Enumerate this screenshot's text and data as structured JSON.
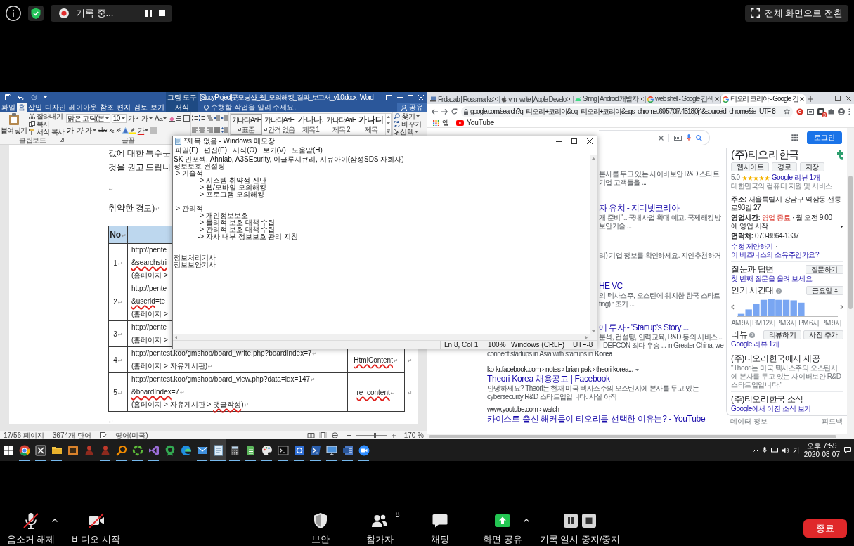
{
  "top_bar": {
    "recording_label": "기록 중...",
    "fullscreen_button": "전체 화면으로 전환"
  },
  "word": {
    "context_label": "그림 도구",
    "title": "[StudyProject]굿모닝샵_웹_모의해킹_결과_보고서_v1.0.docx - Word",
    "tabs": [
      {
        "label": "파일",
        "selected": false,
        "contextual": false
      },
      {
        "label": "홈",
        "selected": true,
        "contextual": false
      },
      {
        "label": "삽입",
        "selected": false,
        "contextual": false
      },
      {
        "label": "디자인",
        "selected": false,
        "contextual": false
      },
      {
        "label": "레이아웃",
        "selected": false,
        "contextual": false
      },
      {
        "label": "참조",
        "selected": false,
        "contextual": false
      },
      {
        "label": "편지",
        "selected": false,
        "contextual": false
      },
      {
        "label": "검토",
        "selected": false,
        "contextual": false
      },
      {
        "label": "보기",
        "selected": false,
        "contextual": false
      },
      {
        "label": "서식",
        "selected": false,
        "contextual": true
      }
    ],
    "tell_me": {
      "placeholder": "수행할 작업을 알려 주세요."
    },
    "share": "공유",
    "clipboard": {
      "paste": "붙여넣기",
      "cut": "잘라내기",
      "copy": "복사",
      "format_painter": "서식 복사",
      "label": "클립보드"
    },
    "font": {
      "name": "맑은 고딕(본",
      "size": "10",
      "grow": "가",
      "shrink": "가",
      "change_case": "Aa",
      "bold": "가",
      "italic": "가",
      "underline": "가",
      "strikethrough": "abc",
      "subscript": "x₂",
      "superscript": "x²",
      "font_color": "가",
      "label": "글꼴"
    },
    "styles": [
      {
        "preview": "가나다AaE",
        "label": "표준",
        "kind": "body",
        "selected": true,
        "paragraph_mark": true
      },
      {
        "preview": "가나다AaE",
        "label": "간격 없음",
        "kind": "body",
        "selected": false,
        "paragraph_mark": true
      },
      {
        "preview": "가나다.",
        "label": "제목 1",
        "kind": "heading",
        "selected": false,
        "paragraph_mark": false
      },
      {
        "preview": "가나다AaE",
        "label": "제목 2",
        "kind": "body",
        "selected": false,
        "paragraph_mark": false
      },
      {
        "preview": "가나디",
        "label": "제목",
        "kind": "title",
        "selected": false,
        "paragraph_mark": false
      }
    ],
    "editing": {
      "find": "찾기",
      "replace": "바꾸기",
      "select": "선택"
    },
    "document": {
      "paragraphs": [
        {
          "text": "값에 대한 특수문"
        },
        {
          "text": "것을 권고 드립니"
        },
        {
          "mark": "↵"
        },
        {
          "text": "취약한 경로)",
          "mark": "↵"
        }
      ],
      "table": {
        "header": {
          "text": "No",
          "mark": "↵"
        },
        "rows": [
          {
            "number": "1",
            "mark": "↵",
            "lines": [
              {
                "parts": [
                  {
                    "text": "http://pente",
                    "misspelled": false
                  }
                ]
              },
              {
                "parts": [
                  {
                    "text": "&searchstri",
                    "misspelled": true
                  }
                ]
              },
              {
                "parts": [
                  {
                    "text": "(홈페이지 >",
                    "misspelled": false
                  }
                ]
              }
            ]
          },
          {
            "number": "2",
            "mark": "↵",
            "lines": [
              {
                "parts": [
                  {
                    "text": "http://pente",
                    "misspelled": false
                  }
                ]
              },
              {
                "parts": [
                  {
                    "text": "&userid",
                    "misspelled": true
                  },
                  {
                    "text": "=te",
                    "misspelled": false
                  }
                ]
              },
              {
                "parts": [
                  {
                    "text": "(홈페이지 >",
                    "misspelled": false
                  }
                ]
              }
            ]
          },
          {
            "number": "3",
            "mark": "↵",
            "lines": [
              {
                "parts": [
                  {
                    "text": "http://pente",
                    "misspelled": false
                  }
                ]
              },
              {
                "parts": [
                  {
                    "text": "(홈페이지 >",
                    "misspelled": false
                  }
                ]
              }
            ]
          },
          {
            "number": "4",
            "mark": "↵",
            "lines": [
              {
                "parts": [
                  {
                    "text": "http://pentest.koo/gmshop/board_write.php?boardIndex=7",
                    "misspelled": false
                  }
                ],
                "mark": "↵"
              },
              {
                "parts": [
                  {
                    "text": "(홈페이지 > 자유게시판)",
                    "misspelled": false
                  }
                ],
                "mark": "↵"
              }
            ],
            "param": {
              "text": "HtmlContent",
              "misspelled": true,
              "mark": "↵"
            },
            "end_mark": "↵"
          },
          {
            "number": "5",
            "mark": "↵",
            "lines": [
              {
                "parts": [
                  {
                    "text": "http://pentest.koo/gmshop/board_view.php?data=idx=147",
                    "misspelled": false
                  }
                ],
                "mark": "↵"
              },
              {
                "parts": [
                  {
                    "text": "&boardIndex",
                    "misspelled": true
                  },
                  {
                    "text": "=7",
                    "misspelled": false
                  }
                ],
                "mark": "↵"
              },
              {
                "parts": [
                  {
                    "text": "(홈페이지 > 자유게시판 > ",
                    "misspelled": false
                  },
                  {
                    "text": "댓글작성",
                    "misspelled": true
                  },
                  {
                    "text": ")",
                    "misspelled": false
                  }
                ],
                "mark": "↵"
              }
            ],
            "param": {
              "text": "re_content",
              "misspelled": true,
              "mark": "↵"
            },
            "end_mark": "↵"
          }
        ]
      },
      "after_mark": "↵"
    },
    "status": {
      "page": "17/56 페이지",
      "words": "3674개 단어",
      "language": "영어(미국)",
      "views": [
        {
          "kind": "read",
          "selected": false
        },
        {
          "kind": "print",
          "selected": true
        },
        {
          "kind": "web",
          "selected": false
        }
      ],
      "zoom_slider": {
        "level": 0.62
      },
      "zoom": "170 %"
    }
  },
  "notepad": {
    "title": "*제목 없음 - Windows 메모장",
    "menu": [
      "파일(F)",
      "편집(E)",
      "서식(O)",
      "보기(V)",
      "도움말(H)"
    ],
    "content": "SK 인포섹, Ahnlab, A3SEcurity, 이글루시큐리, 시큐아이(삼성SDS 자회사)\n정보보호 컨설팅\n-> 기술적\n\t\t-> 시스템 취약점 진단\n\t\t-> 웹/모바일 모의해킹\n\t\t-> 프로그램 모의해킹\n\n-> 관리적\n\t\t-> 개인정보보호\n\t\t-> 물리적 보호 대책 수립\n\t\t-> 관리적 보호 대책 수립\n\t\t-> 자사 내부 정보보호 관리 지침\n\n\n정보처리기사\n정보보안기사",
    "status": [
      "Ln 8, Col 1",
      "100%",
      "Windows (CRLF)",
      "UTF-8"
    ]
  },
  "chrome": {
    "tabs": [
      {
        "title": "FridaLab | Ross marks",
        "kind": "laptop",
        "selected": false
      },
      {
        "title": "vm_write | Apple Develo",
        "kind": "apple",
        "selected": false
      },
      {
        "title": "String | Android 개발자",
        "kind": "robot",
        "selected": false
      },
      {
        "title": "web shell - Google 검색",
        "kind": "ring",
        "selected": false
      },
      {
        "title": "티오리 코리아 - Google 검",
        "kind": "ring",
        "selected": true
      }
    ],
    "url": "google.com/search?q=티오리+코리아&oq=티오리+코리아&aqs=chrome..69i57j0l7.4518j0j4&sourceid=chrome&ie=UTF-8",
    "extension_badge": "3",
    "bookmarks": [
      {
        "label": "앱",
        "kind": "apps"
      },
      {
        "label": "YouTube",
        "kind": "video"
      }
    ],
    "login": "로그인",
    "results": [
      {
        "lines": [
          {
            "kind": "cut",
            "text": "본사를 두고 있는 사이버보안 R&D 스타트"
          },
          {
            "kind": "cut",
            "text": "기업 고객들을 ..."
          }
        ]
      },
      {
        "lines": [
          {
            "kind": "cut_title",
            "text": "자 유치 - 지디넷코리아"
          },
          {
            "kind": "cut",
            "text": "개 준비\"... 국내사업 확대 예고. 국제해킹방"
          },
          {
            "kind": "cut",
            "text": "보안기술 ..."
          }
        ]
      },
      {
        "lines": [
          {
            "kind": "cut",
            "text": "리) 기업 정보를 확인하세요. 지인추천하거"
          }
        ]
      },
      {
        "lines": [
          {
            "kind": "cut_title",
            "text": "HE VC"
          },
          {
            "kind": "cut",
            "text": "의 텍사스주, 오스틴에 위치한 한국 스타트"
          },
          {
            "kind": "cut",
            "text": "ting) : 조기 ..."
          }
        ]
      },
      {
        "lines": [
          {
            "kind": "cut_title",
            "text": "에 투자 - 'Startup's Story ..."
          },
          {
            "kind": "cut",
            "text": "분석, 컨설팅, 인력교육, R&D 등의 서비스 ..."
          },
          {
            "kind": "partial",
            "text": "DEFCON 최다 우승 ... in Greater China, we"
          },
          {
            "kind": "snippet",
            "text": "connect startups in Asia with startups in **Korea**"
          }
        ]
      },
      {
        "lines": [
          {
            "kind": "cite",
            "text": "ko-kr.facebook.com › notes › brian-pak › theori-korea...",
            "menu": true
          },
          {
            "kind": "title",
            "text": "Theori Korea 채용공고 | Facebook"
          },
          {
            "kind": "snippet",
            "text": "안녕하세요? Theori는 현재 미국 텍사스주의 오스틴시에 본사를 두고 있는 cybersecurity R&D 스타트업입니다. 사실 아직"
          }
        ]
      },
      {
        "lines": [
          {
            "kind": "cite",
            "text": "www.youtube.com › watch",
            "menu": false
          },
          {
            "kind": "title",
            "text": "카이스트 출신 해커들이 티오리를 선택한 이유는? - YouTube"
          }
        ]
      }
    ],
    "panel": {
      "title": "(주)티오리한국",
      "actions": [
        "웹사이트",
        "경로",
        "저장"
      ],
      "rating": "5.0",
      "stars": 5,
      "reviews_link": "Google 리뷰 1개",
      "category": "대한민국의 컴퓨터 지원 및 서비스",
      "address": "**주소:** 서울특별시 강남구 역삼동 선릉로93길 27",
      "hours": {
        "label": "영업시간:",
        "status": "영업 종료",
        "open": false,
        "detail": "· 월 오전 9:00에 영업 시작"
      },
      "phone": "**연락처:** 070-8864-1337",
      "edit_links": {
        "items": [
          "수정 제안하기",
          "이 비즈니스의 소유주인가요?"
        ],
        "separator": "·"
      },
      "qa": {
        "title": "질문과 답변",
        "link": "첫 번째 질문을 올려 보세요.",
        "button": "질문하기"
      },
      "popular": {
        "title": "인기 시간대",
        "day": "금요일",
        "labels": [
          "AM 9시",
          "PM 12시",
          "PM 3시",
          "PM 6시",
          "PM 9시"
        ]
      },
      "reviews": {
        "title": "리뷰",
        "buttons": [
          "리뷰하기",
          "사진 추가"
        ],
        "link": "Google 리뷰 1개"
      },
      "from": {
        "title": "(주)티오리한국에서 제공",
        "quote": "\"Theori는 미국 텍사스주의 오스틴시에 본사를 두고 있는 사이버보안 R&D 스타트업입니다.\""
      },
      "news": {
        "title": "(주)티오리한국 소식",
        "link": "Google에서 이전 소식 보기"
      },
      "footer": [
        "데이터 정보",
        "피드백"
      ]
    }
  },
  "taskbar": {
    "apps": [
      {
        "kind": "browser",
        "running": true,
        "selected": false
      },
      {
        "kind": "spreadsheet",
        "running": true,
        "selected": false
      },
      {
        "kind": "folder",
        "running": true,
        "selected": false
      },
      {
        "kind": "app_d",
        "running": false,
        "selected": false
      },
      {
        "kind": "figure",
        "running": false,
        "selected": false
      },
      {
        "kind": "figure",
        "running": true,
        "selected": false
      },
      {
        "kind": "magnifier",
        "running": true,
        "selected": false
      },
      {
        "kind": "ring",
        "running": true,
        "selected": false
      },
      {
        "kind": "code",
        "running": true,
        "selected": false
      },
      {
        "kind": "badge",
        "running": false,
        "selected": false
      },
      {
        "kind": "swirl",
        "running": false,
        "selected": false
      },
      {
        "kind": "envelope",
        "running": true,
        "selected": false
      },
      {
        "kind": "notepad",
        "running": true,
        "selected": true
      },
      {
        "kind": "calculator",
        "running": true,
        "selected": false
      },
      {
        "kind": "sheet",
        "running": true,
        "selected": false
      },
      {
        "kind": "palette",
        "running": true,
        "selected": false
      },
      {
        "kind": "terminal",
        "running": true,
        "selected": false
      },
      {
        "kind": "numbered",
        "running": true,
        "selected": false
      },
      {
        "kind": "shell",
        "running": true,
        "selected": false
      },
      {
        "kind": "computer",
        "running": true,
        "selected": false
      },
      {
        "kind": "word",
        "running": true,
        "selected": false
      },
      {
        "kind": "camera",
        "running": true,
        "selected": false
      }
    ],
    "ime": "가",
    "time": "오후 7:59",
    "date": "2020-08-07"
  },
  "toolbar": {
    "buttons": [
      {
        "kind": "audio",
        "label": "음소거 해제",
        "caret": true,
        "off": true
      },
      {
        "kind": "video",
        "label": "비디오 시작",
        "caret": false,
        "off": true
      },
      {
        "kind": "security",
        "label": "보안",
        "caret": false,
        "off": false
      },
      {
        "kind": "participants",
        "label": "참가자",
        "count": "8",
        "caret": false,
        "off": false
      },
      {
        "kind": "chat",
        "label": "채팅",
        "caret": false,
        "off": false
      },
      {
        "kind": "share",
        "label": "화면 공유",
        "caret": true,
        "off": false
      },
      {
        "kind": "record",
        "label": "기록 일시 중지/중지",
        "caret": false,
        "off": false
      }
    ],
    "end": "종료"
  }
}
